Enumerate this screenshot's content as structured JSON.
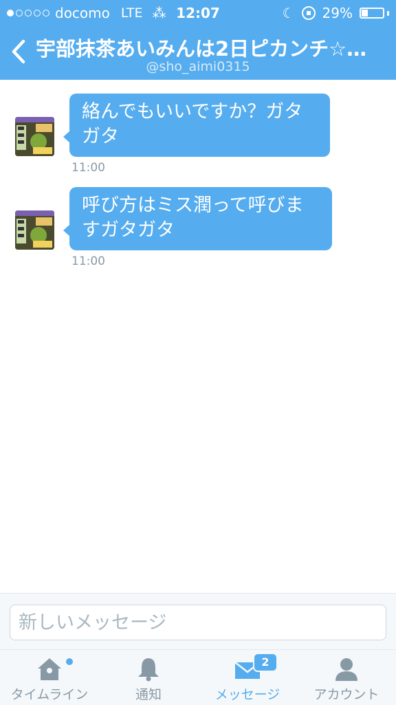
{
  "status_bar": {
    "carrier": "docomo",
    "network": "LTE",
    "time": "12:07",
    "battery_percent": "29%",
    "battery_level": 0.29,
    "signal_bars_filled": 1,
    "signal_bars_total": 5
  },
  "header": {
    "title": "宇部抹茶あいみんは2日ピカンチ☆…",
    "handle": "@sho_aimi0315",
    "back_icon": "chevron-left-icon"
  },
  "messages": [
    {
      "text_line1": "絡んでもいいですか？ガタ",
      "text_line2": "ガタ",
      "time": "11:00"
    },
    {
      "text_line1": "呼び方はミス潤って呼びま",
      "text_line2": "すガタガタ",
      "time": "11:00"
    }
  ],
  "composer": {
    "placeholder": "新しいメッセージ"
  },
  "tabs": [
    {
      "label": "タイムライン",
      "icon": "home-icon",
      "active": false
    },
    {
      "label": "通知",
      "icon": "bell-icon",
      "active": false
    },
    {
      "label": "メッセージ",
      "icon": "envelope-icon",
      "active": true,
      "badge": "2"
    },
    {
      "label": "アカウント",
      "icon": "person-icon",
      "active": false
    }
  ],
  "colors": {
    "accent": "#55acee",
    "inactive": "#8899a6",
    "background": "#ffffff"
  }
}
